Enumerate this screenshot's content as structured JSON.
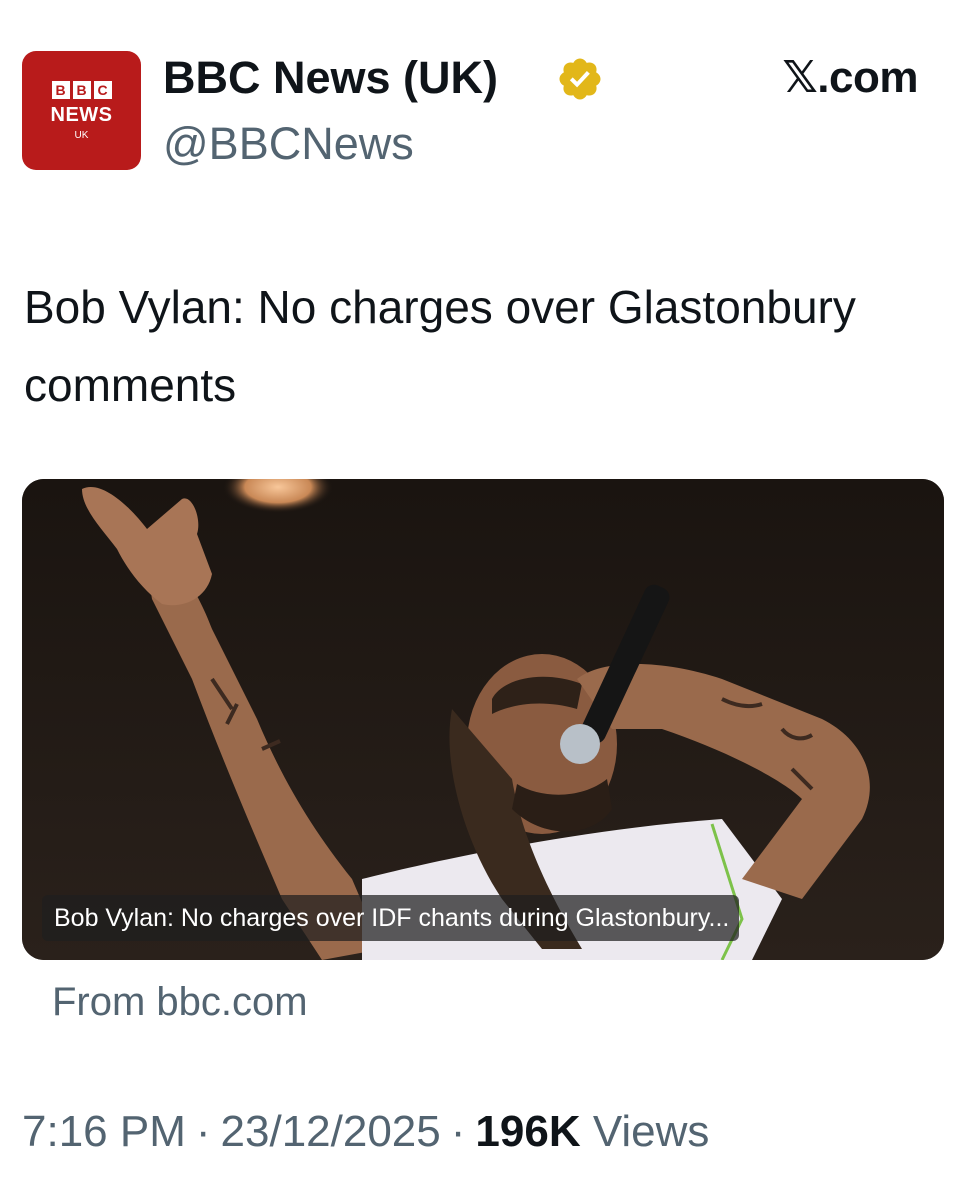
{
  "author": {
    "display_name": "BBC News (UK)",
    "handle": "@BBCNews",
    "verified_badge_color": "#e2b719",
    "avatar": {
      "blocks": [
        "B",
        "B",
        "C"
      ],
      "wordmark": "NEWS",
      "region": "UK",
      "background": "#b81b1b"
    }
  },
  "brand": {
    "label": "𝕏.com"
  },
  "tweet": {
    "text": "Bob Vylan: No charges over Glastonbury comments"
  },
  "link_card": {
    "image_description_icon": "performer-photo",
    "title": "Bob Vylan: No charges over IDF chants during Glastonbury...",
    "source": "From bbc.com"
  },
  "meta": {
    "time": "7:16 PM",
    "date": "23/12/2025",
    "views_count": "196K",
    "views_label": "Views",
    "separator": "·"
  }
}
